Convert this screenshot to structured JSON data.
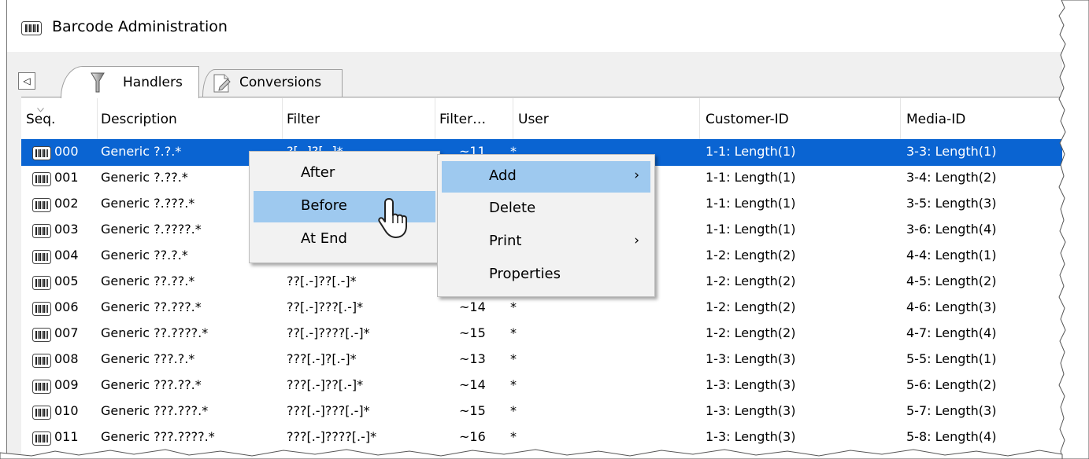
{
  "window": {
    "title": "Barcode Administration"
  },
  "tabs": [
    {
      "label": "Handlers",
      "icon": "funnel-icon",
      "active": true
    },
    {
      "label": "Conversions",
      "icon": "document-edit-icon",
      "active": false
    }
  ],
  "table": {
    "columns": [
      "Seq.",
      "Description",
      "Filter",
      "Filter…",
      "User",
      "Customer-ID",
      "Media-ID"
    ],
    "rows": [
      {
        "seq": "000",
        "description": "Generic ?.?.*",
        "filter": "?[.-]?[.-]*",
        "filter_len": "~11",
        "user": "*",
        "customer_id": "1-1: Length(1)",
        "media_id": "3-3: Length(1)"
      },
      {
        "seq": "001",
        "description": "Generic ?.??.*",
        "filter": "",
        "filter_len": "",
        "user": "",
        "customer_id": "1-1: Length(1)",
        "media_id": "3-4: Length(2)"
      },
      {
        "seq": "002",
        "description": "Generic ?.???.*",
        "filter": "",
        "filter_len": "",
        "user": "",
        "customer_id": "1-1: Length(1)",
        "media_id": "3-5: Length(3)"
      },
      {
        "seq": "003",
        "description": "Generic ?.????.*",
        "filter": "",
        "filter_len": "",
        "user": "",
        "customer_id": "1-1: Length(1)",
        "media_id": "3-6: Length(4)"
      },
      {
        "seq": "004",
        "description": "Generic ??.?.*",
        "filter": "",
        "filter_len": "",
        "user": "",
        "customer_id": "1-2: Length(2)",
        "media_id": "4-4: Length(1)"
      },
      {
        "seq": "005",
        "description": "Generic ??.??.*",
        "filter": "??[.-]??[.-]*",
        "filter_len": "",
        "user": "",
        "customer_id": "1-2: Length(2)",
        "media_id": "4-5: Length(2)"
      },
      {
        "seq": "006",
        "description": "Generic ??.???.*",
        "filter": "??[.-]???[.-]*",
        "filter_len": "~14",
        "user": "*",
        "customer_id": "1-2: Length(2)",
        "media_id": "4-6: Length(3)"
      },
      {
        "seq": "007",
        "description": "Generic ??.????.*",
        "filter": "??[.-]????[.-]*",
        "filter_len": "~15",
        "user": "*",
        "customer_id": "1-2: Length(2)",
        "media_id": "4-7: Length(4)"
      },
      {
        "seq": "008",
        "description": "Generic ???.?.*",
        "filter": "???[.-]?[.-]*",
        "filter_len": "~13",
        "user": "*",
        "customer_id": "1-3: Length(3)",
        "media_id": "5-5: Length(1)"
      },
      {
        "seq": "009",
        "description": "Generic ???.??.*",
        "filter": "???[.-]??[.-]*",
        "filter_len": "~14",
        "user": "*",
        "customer_id": "1-3: Length(3)",
        "media_id": "5-6: Length(2)"
      },
      {
        "seq": "010",
        "description": "Generic ???.???.*",
        "filter": "???[.-]???[.-]*",
        "filter_len": "~15",
        "user": "*",
        "customer_id": "1-3: Length(3)",
        "media_id": "5-7: Length(3)"
      },
      {
        "seq": "011",
        "description": "Generic ???.????.*",
        "filter": "???[.-]????[.-]*",
        "filter_len": "~16",
        "user": "*",
        "customer_id": "1-3: Length(3)",
        "media_id": "5-8: Length(4)"
      }
    ]
  },
  "context_menu": {
    "items": [
      {
        "label": "Add",
        "submenu": true,
        "highlighted": true
      },
      {
        "label": "Delete",
        "submenu": false
      },
      {
        "label": "Print",
        "submenu": true
      },
      {
        "label": "Properties",
        "submenu": false
      }
    ],
    "submenu_arrow": "›"
  },
  "submenu": {
    "items": [
      {
        "label": "After"
      },
      {
        "label": "Before",
        "highlighted": true
      },
      {
        "label": "At End"
      }
    ]
  },
  "colors": {
    "selection": "#0a64d2",
    "menu_highlight": "#9ec9ef",
    "menu_background": "#f2f2f2"
  }
}
